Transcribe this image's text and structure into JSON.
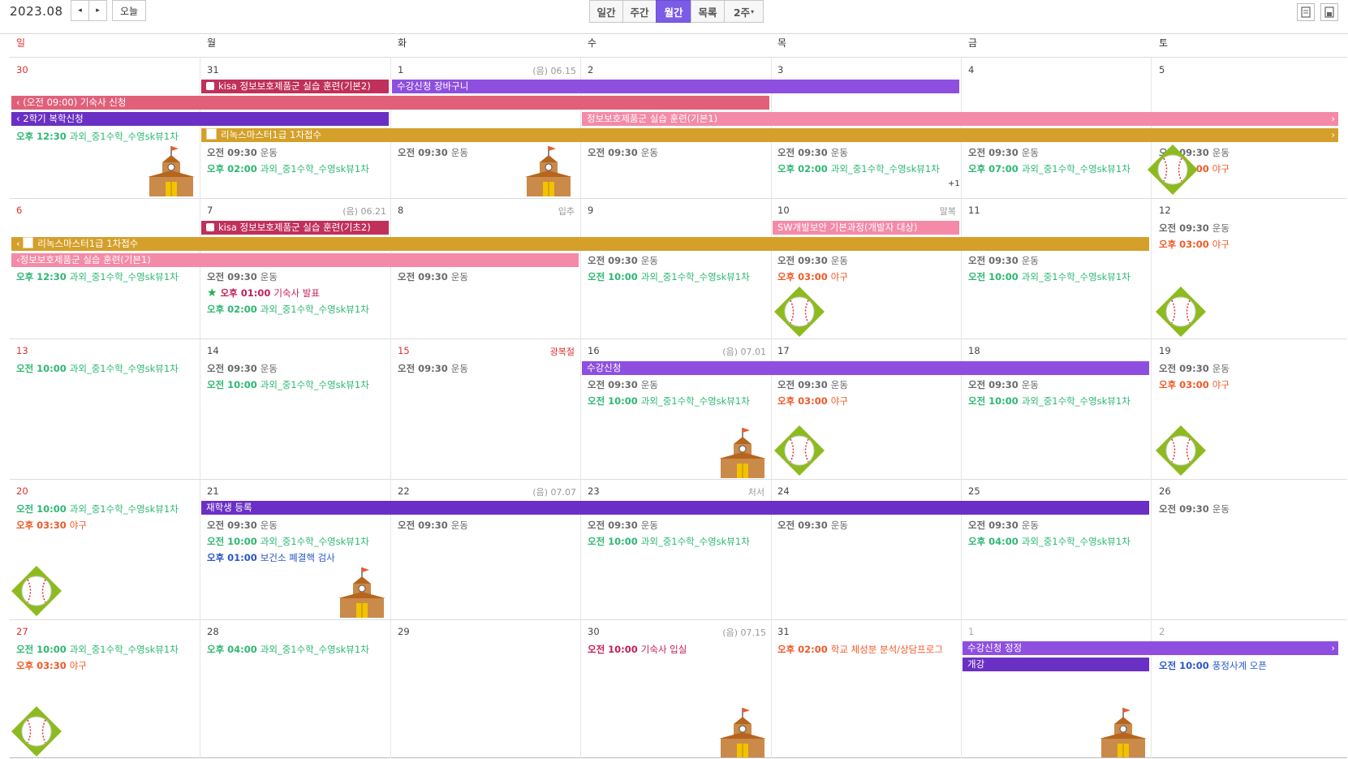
{
  "header": {
    "month": "2023.08",
    "prev": "◂",
    "next": "▸",
    "today": "오늘",
    "views": [
      "일간",
      "주간",
      "월간",
      "목록",
      "2주"
    ],
    "active_view": "월간",
    "two_week_caret": "▾"
  },
  "weekdays": [
    "일",
    "월",
    "화",
    "수",
    "목",
    "금",
    "토"
  ],
  "weeks": [
    {
      "days": [
        {
          "num": "30",
          "red": true
        },
        {
          "num": "31"
        },
        {
          "num": "1",
          "sub": "(음) 06.15"
        },
        {
          "num": "2"
        },
        {
          "num": "3"
        },
        {
          "num": "4"
        },
        {
          "num": "5"
        }
      ],
      "extra": "+1"
    },
    {
      "days": [
        {
          "num": "6",
          "red": true
        },
        {
          "num": "7",
          "sub": "(음) 06.21"
        },
        {
          "num": "8",
          "sub": "입추"
        },
        {
          "num": "9"
        },
        {
          "num": "10",
          "sub": "말복"
        },
        {
          "num": "11"
        },
        {
          "num": "12"
        }
      ]
    },
    {
      "days": [
        {
          "num": "13",
          "red": true
        },
        {
          "num": "14"
        },
        {
          "num": "15",
          "red": true,
          "sub": "광복절"
        },
        {
          "num": "16",
          "sub": "(음) 07.01"
        },
        {
          "num": "17"
        },
        {
          "num": "18"
        },
        {
          "num": "19"
        }
      ]
    },
    {
      "days": [
        {
          "num": "20",
          "red": true
        },
        {
          "num": "21"
        },
        {
          "num": "22",
          "sub": "(음) 07.07"
        },
        {
          "num": "23",
          "sub": "처서"
        },
        {
          "num": "24"
        },
        {
          "num": "25"
        },
        {
          "num": "26"
        }
      ]
    },
    {
      "days": [
        {
          "num": "27",
          "red": true
        },
        {
          "num": "28"
        },
        {
          "num": "29"
        },
        {
          "num": "30",
          "sub": "(음) 07.15"
        },
        {
          "num": "31"
        },
        {
          "num": "1",
          "gray": true
        },
        {
          "num": "2",
          "gray": true
        }
      ]
    }
  ],
  "bars": {
    "kisa1": "kisa 정보보호제품군 실습 훈련(기본2)",
    "sugang_basket": "수강신청 장바구니",
    "dorm_apply": "(오전 09:00) 기숙사 신청",
    "readmit": "2학기 복학신청",
    "infosec_basic1": "정보보호제품군 실습 훈련(기본1)",
    "ribok1": "리녹스마스터1급 1차접수",
    "kisa2": "kisa 정보보호제품군 실습 훈련(기초2)",
    "sw_security": "SW개발보안 기본과정(개발자 대상)",
    "ribok2": "리녹스마스터1급 1차접수",
    "infosec_basic1b": "정보보호제품군 실습 훈련(기본1)",
    "sugang": "수강신청",
    "enroll": "재학생 등록",
    "sugang_fix": "수강신청 정정",
    "open": "개강"
  },
  "colors": {
    "pink_red": "#e0607a",
    "purple": "#8e4fe0",
    "dark_purple": "#6a2fc4",
    "pink": "#f48aa8",
    "gold": "#d4a02a",
    "crimson": "#c0305a",
    "green_text": "#2eb872",
    "orange_text": "#f05a28",
    "blue_text": "#2a56c6"
  },
  "events": {
    "am0930_ex": {
      "time": "오전 09:30",
      "title": "운동"
    },
    "am1000_tutor": {
      "time": "오전 10:00",
      "title": "과외_중1수학_수영sk뷰1차"
    },
    "pm1230_tutor": {
      "time": "오후 12:30",
      "title": "과외_중1수학_수영sk뷰1차"
    },
    "pm0200_tutor": {
      "time": "오후 02:00",
      "title": "과외_중1수학_수영sk뷰1차"
    },
    "pm0700_tutor": {
      "time": "오후 07:00",
      "title": "과외_중1수학_수영sk뷰1차"
    },
    "pm0400_tutor": {
      "time": "오후 04:00",
      "title": "과외_중1수학_수영sk뷰1차"
    },
    "pm0300_base": {
      "time": "오후 03:00",
      "title": "야구"
    },
    "pm0330_base": {
      "time": "오후 03:30",
      "title": "야구"
    },
    "pm0100_dorm": {
      "time": "오후 01:00",
      "title": "기숙사 발표"
    },
    "pm0100_health": {
      "time": "오후 01:00",
      "title": "보건소 폐결핵 검사"
    },
    "am1000_dorm_in": {
      "time": "오전 10:00",
      "title": "기숙사 입실"
    },
    "pm0200_school": {
      "time": "오후 02:00",
      "title": "학교 체성분 분석/상담프로그"
    },
    "am1000_wind": {
      "time": "오전 10:00",
      "title": "풍정사계 오픈"
    }
  },
  "icons": [
    "calendar-print-icon",
    "calendar-save-icon",
    "school-icon",
    "baseball-icon",
    "star-icon",
    "checkbox-icon",
    "document-icon"
  ]
}
